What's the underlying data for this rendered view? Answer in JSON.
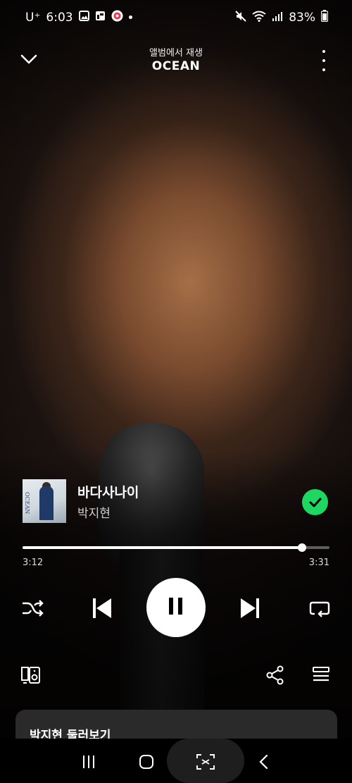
{
  "status_bar": {
    "carrier": "U⁺",
    "time": "6:03",
    "battery": "83%"
  },
  "header": {
    "context_label": "앨범에서 재생",
    "context_title": "OCEAN"
  },
  "track": {
    "title": "바다사나이",
    "artist": "박지현",
    "album_art_text": "OCEAN",
    "saved": true
  },
  "playback": {
    "elapsed": "3:12",
    "total": "3:31",
    "progress": 0.91,
    "state": "playing"
  },
  "explore": {
    "title": "박지현 둘러보기"
  },
  "icons": {
    "back": "chevron-down-icon",
    "more": "more-vertical-icon",
    "saved": "check-circle-icon",
    "shuffle": "shuffle-icon",
    "previous": "skip-previous-icon",
    "pause": "pause-icon",
    "next": "skip-next-icon",
    "repeat": "repeat-icon",
    "devices": "connect-device-icon",
    "share": "share-icon",
    "queue": "queue-icon"
  },
  "colors": {
    "accent": "#1ed760",
    "card": "#2a2a2a"
  }
}
